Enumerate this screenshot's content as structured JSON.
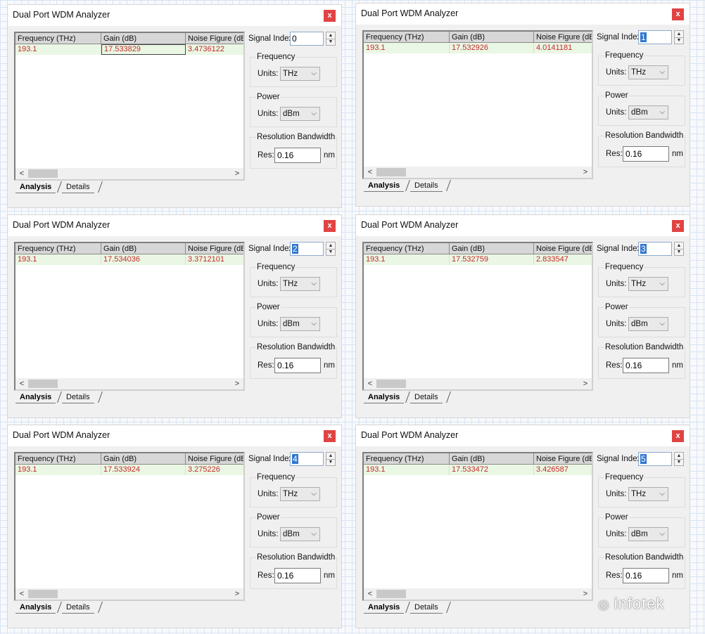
{
  "window_title": "Dual Port WDM Analyzer",
  "close_label": "x",
  "columns": [
    "Frequency (THz)",
    "Gain (dB)",
    "Noise Figure (dB)"
  ],
  "signal_index_label": "Signal Index:",
  "frequency_group": "Frequency",
  "power_group": "Power",
  "resolution_group": "Resolution Bandwidth",
  "units_label": "Units:",
  "res_label": "Res:",
  "nm_label": "nm",
  "tab_analysis": "Analysis",
  "tab_details": "Details",
  "windows": [
    {
      "signal_index": "0",
      "row": [
        "193.1",
        "17.533829",
        "3.4736122"
      ],
      "freq_units": "THz",
      "power_units": "dBm",
      "res": "0.16"
    },
    {
      "signal_index": "1",
      "row": [
        "193.1",
        "17.532926",
        "4.0141181"
      ],
      "freq_units": "THz",
      "power_units": "dBm",
      "res": "0.16"
    },
    {
      "signal_index": "2",
      "row": [
        "193.1",
        "17.534036",
        "3.3712101"
      ],
      "freq_units": "THz",
      "power_units": "dBm",
      "res": "0.16"
    },
    {
      "signal_index": "3",
      "row": [
        "193.1",
        "17.532759",
        "2.833547"
      ],
      "freq_units": "THz",
      "power_units": "dBm",
      "res": "0.16"
    },
    {
      "signal_index": "4",
      "row": [
        "193.1",
        "17.533924",
        "3.275226"
      ],
      "freq_units": "THz",
      "power_units": "dBm",
      "res": "0.16"
    },
    {
      "signal_index": "5",
      "row": [
        "193.1",
        "17.533472",
        "3.426587"
      ],
      "freq_units": "THz",
      "power_units": "dBm",
      "res": "0.16"
    }
  ],
  "watermark": "infotek"
}
